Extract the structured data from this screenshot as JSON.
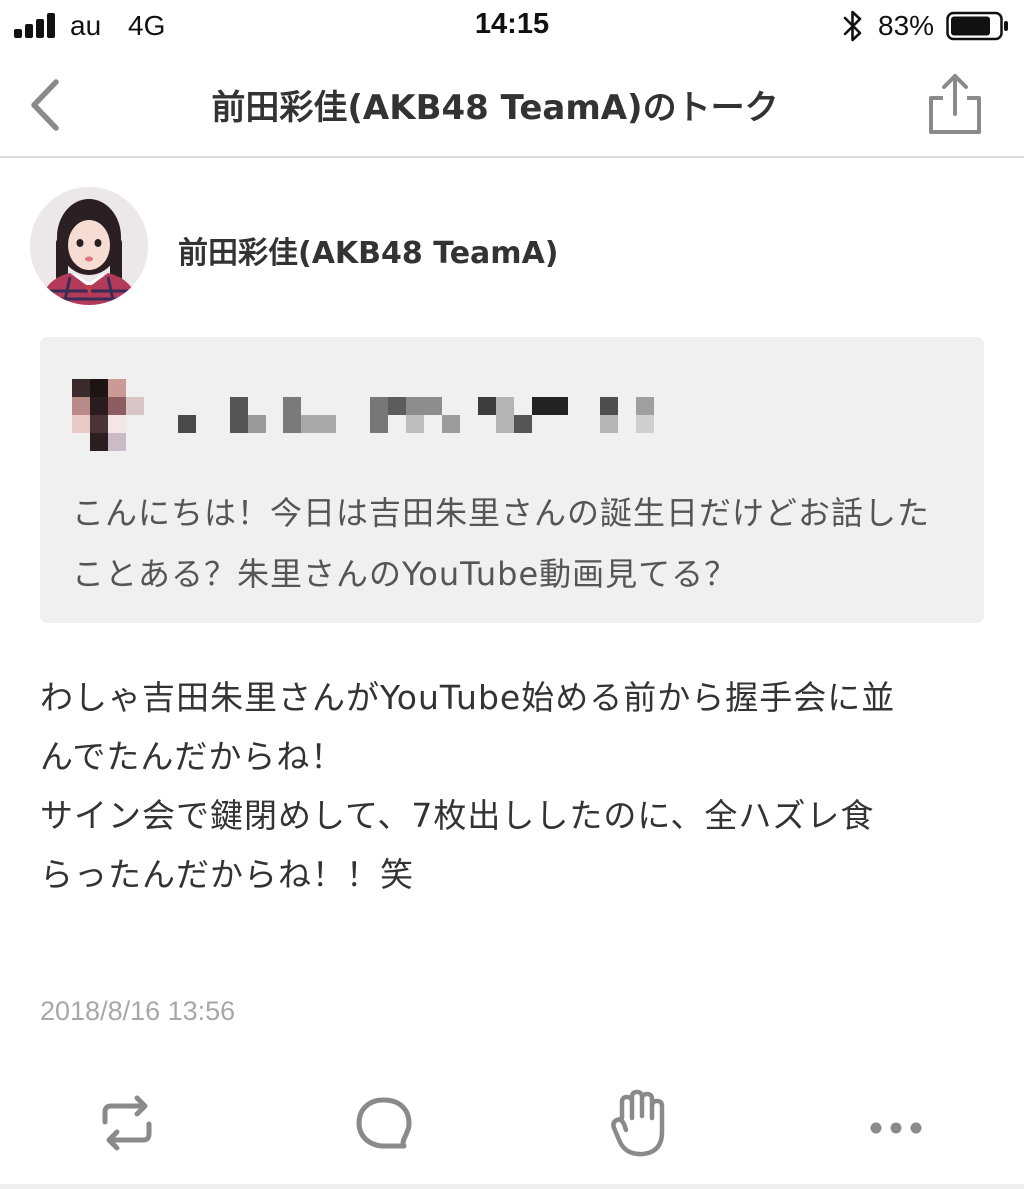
{
  "status_bar": {
    "carrier": "au",
    "network": "4G",
    "time": "14:15",
    "battery_percent": "83%",
    "battery_level": 0.83
  },
  "nav": {
    "title": "前田彩佳(AKB48 TeamA)のトーク",
    "back_icon": "chevron-left-icon",
    "share_icon": "share-icon"
  },
  "post": {
    "author": "前田彩佳(AKB48 TeamA)",
    "question": {
      "asker": "",
      "text": "こんにちは！今日は吉田朱里さんの誕生日だけどお話したことある？朱里さんのYouTube動画見てる？"
    },
    "answer_lines": [
      "わしゃ吉田朱里さんがYouTube始める前から握手会に並",
      "んでたんだからね！",
      "サイン会で鍵閉めして、7枚出ししたのに、全ハズレ食",
      "らったんだからね！！笑"
    ],
    "timestamp": "2018/8/16 13:56"
  },
  "actions": [
    {
      "name": "repost",
      "icon": "repost-icon"
    },
    {
      "name": "comment",
      "icon": "comment-bubble-icon"
    },
    {
      "name": "clap",
      "icon": "clap-hand-icon"
    },
    {
      "name": "more",
      "icon": "more-dots-icon"
    }
  ],
  "colors": {
    "text_primary": "#333333",
    "text_secondary": "#555555",
    "text_muted": "#a8a8a8",
    "icon_gray": "#8a8a8a",
    "card_bg": "#f0f0f0",
    "divider": "#dcdcdc"
  }
}
